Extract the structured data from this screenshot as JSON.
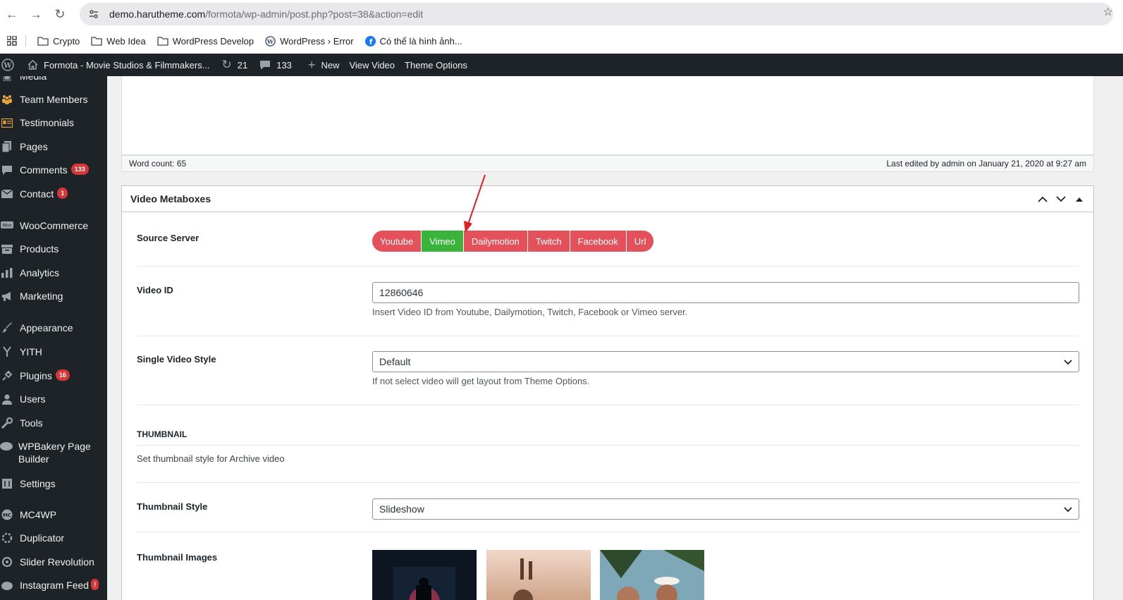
{
  "browser": {
    "url_host": "demo.harutheme.com",
    "url_path": "/formota/wp-admin/post.php?post=38&action=edit",
    "bookmarks": [
      "Crypto",
      "Web Idea",
      "WordPress Develop",
      "WordPress › Error",
      "Có thể là hình ảnh..."
    ]
  },
  "adminbar": {
    "site_name": "Formota - Movie Studios & Filmmakers...",
    "updates": "21",
    "comments": "133",
    "new_label": "New",
    "view_label": "View Video",
    "theme_options": "Theme Options"
  },
  "sidebar": {
    "items": [
      {
        "label": "Media",
        "icon": "media-icon"
      },
      {
        "label": "Team Members",
        "icon": "team-icon"
      },
      {
        "label": "Testimonials",
        "icon": "testimonial-icon"
      },
      {
        "label": "Pages",
        "icon": "pages-icon"
      },
      {
        "label": "Comments",
        "icon": "comments-icon",
        "badge": "133"
      },
      {
        "label": "Contact",
        "icon": "mail-icon",
        "badge": "1"
      },
      {
        "label": "WooCommerce",
        "icon": "woo-icon"
      },
      {
        "label": "Products",
        "icon": "products-icon"
      },
      {
        "label": "Analytics",
        "icon": "analytics-icon"
      },
      {
        "label": "Marketing",
        "icon": "megaphone-icon"
      },
      {
        "label": "Appearance",
        "icon": "brush-icon"
      },
      {
        "label": "YITH",
        "icon": "yith-icon"
      },
      {
        "label": "Plugins",
        "icon": "plugin-icon",
        "badge": "16"
      },
      {
        "label": "Users",
        "icon": "user-icon"
      },
      {
        "label": "Tools",
        "icon": "wrench-icon"
      },
      {
        "label": "WPBakery Page Builder",
        "icon": "wpbakery-icon"
      },
      {
        "label": "Settings",
        "icon": "settings-icon"
      },
      {
        "label": "MC4WP",
        "icon": "mc4wp-icon"
      },
      {
        "label": "Duplicator",
        "icon": "duplicator-icon"
      },
      {
        "label": "Slider Revolution",
        "icon": "slider-icon"
      },
      {
        "label": "Instagram Feed",
        "icon": "instagram-icon",
        "badge": "!"
      }
    ]
  },
  "editor": {
    "word_count": "Word count: 65",
    "last_edited": "Last edited by admin on January 21, 2020 at 9:27 am"
  },
  "metabox": {
    "title": "Video Metaboxes",
    "source_server_label": "Source Server",
    "servers": [
      "Youtube",
      "Vimeo",
      "Dailymotion",
      "Twitch",
      "Facebook",
      "Url"
    ],
    "active_server": "Vimeo",
    "video_id_label": "Video ID",
    "video_id_value": "12860646",
    "video_id_help": "Insert Video ID from Youtube, Dailymotion, Twitch, Facebook or Vimeo server.",
    "single_style_label": "Single Video Style",
    "single_style_value": "Default",
    "single_style_help": "If not select video will get layout from Theme Options.",
    "thumbnail_heading": "THUMBNAIL",
    "thumbnail_desc": "Set thumbnail style for Archive video",
    "thumb_style_label": "Thumbnail Style",
    "thumb_style_value": "Slideshow",
    "thumb_images_label": "Thumbnail Images"
  },
  "colors": {
    "admin_dark": "#1d2327",
    "server_button": "#e5515b",
    "server_active": "#3ab33a",
    "badge": "#d63638",
    "annotation_arrow": "#e02020"
  }
}
